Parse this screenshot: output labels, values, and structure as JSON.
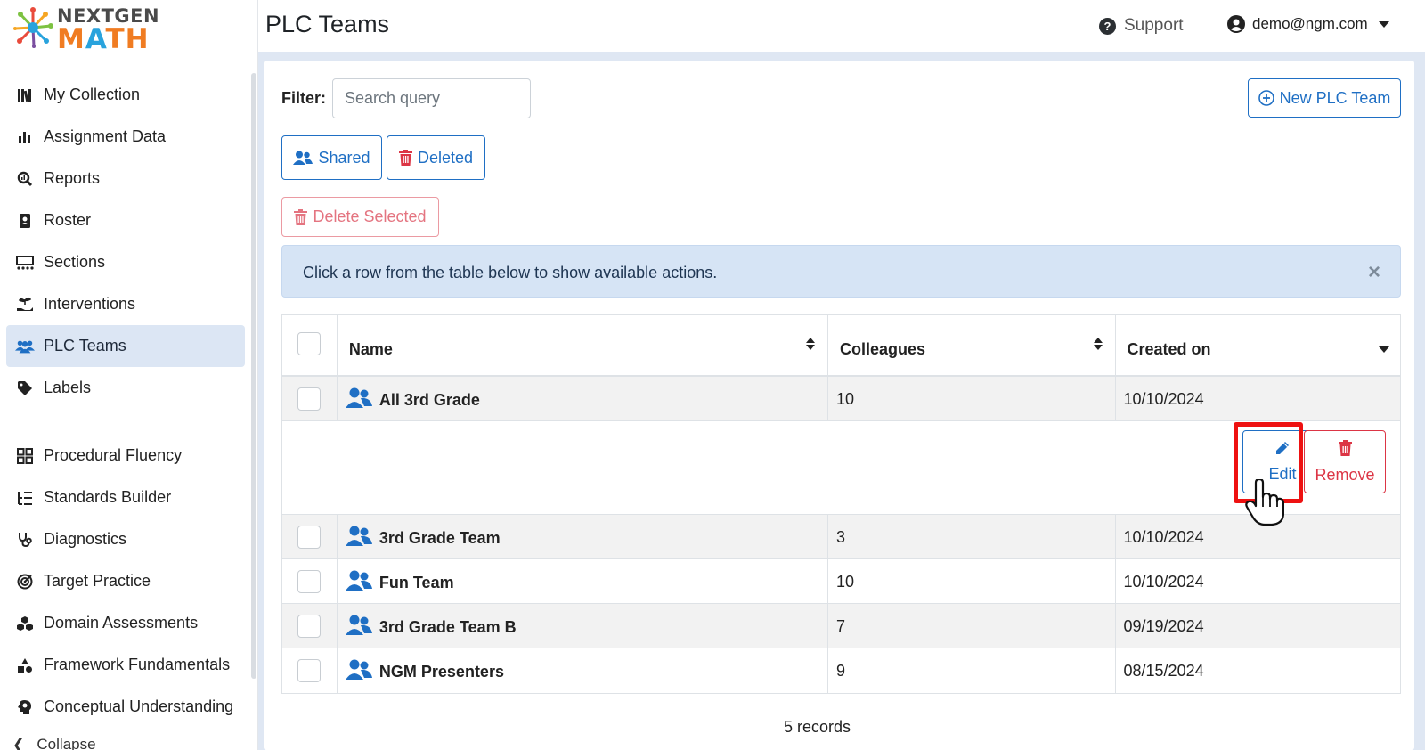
{
  "logo": {
    "line1": "NEXTGEN",
    "line2_m": "M",
    "line2_a": "A",
    "line2_th": "TH"
  },
  "sidebar": {
    "items": [
      {
        "label": "My Collection",
        "icon": "books-icon"
      },
      {
        "label": "Assignment Data",
        "icon": "bar-chart-icon"
      },
      {
        "label": "Reports",
        "icon": "magnify-report-icon"
      },
      {
        "label": "Roster",
        "icon": "contact-book-icon"
      },
      {
        "label": "Sections",
        "icon": "sections-grid-icon"
      },
      {
        "label": "Interventions",
        "icon": "hand-plant-icon"
      },
      {
        "label": "PLC Teams",
        "icon": "people-icon",
        "active": true
      },
      {
        "label": "Labels",
        "icon": "tag-icon"
      }
    ],
    "items2": [
      {
        "label": "Procedural Fluency",
        "icon": "grid-icon"
      },
      {
        "label": "Standards Builder",
        "icon": "list-tree-icon"
      },
      {
        "label": "Diagnostics",
        "icon": "stethoscope-icon"
      },
      {
        "label": "Target Practice",
        "icon": "target-icon"
      },
      {
        "label": "Domain Assessments",
        "icon": "cubes-icon"
      },
      {
        "label": "Framework Fundamentals",
        "icon": "shapes-icon"
      },
      {
        "label": "Conceptual Understanding",
        "icon": "brain-head-icon"
      }
    ],
    "collapse": "Collapse"
  },
  "header": {
    "title": "PLC Teams",
    "support": "Support",
    "user": "demo@ngm.com"
  },
  "filter": {
    "label": "Filter:",
    "placeholder": "Search query"
  },
  "buttons": {
    "new_team": "New PLC Team",
    "shared": "Shared",
    "deleted": "Deleted",
    "delete_selected": "Delete Selected"
  },
  "alert": {
    "message": "Click a row from the table below to show available actions.",
    "close": "×"
  },
  "table": {
    "headers": {
      "name": "Name",
      "colleagues": "Colleagues",
      "created": "Created on"
    },
    "rows": [
      {
        "name": "All 3rd Grade",
        "colleagues": "10",
        "created": "10/10/2024"
      },
      {
        "name": "3rd Grade Team",
        "colleagues": "3",
        "created": "10/10/2024"
      },
      {
        "name": "Fun Team",
        "colleagues": "10",
        "created": "10/10/2024"
      },
      {
        "name": "3rd Grade Team B",
        "colleagues": "7",
        "created": "09/19/2024"
      },
      {
        "name": "NGM Presenters",
        "colleagues": "9",
        "created": "08/15/2024"
      }
    ],
    "actions": {
      "edit": "Edit",
      "remove": "Remove"
    },
    "footer": "5 records"
  },
  "colors": {
    "accent": "#1f6fc4",
    "danger": "#dc3545",
    "active_bg": "#dce6f4",
    "highlight": "#ee1111"
  }
}
